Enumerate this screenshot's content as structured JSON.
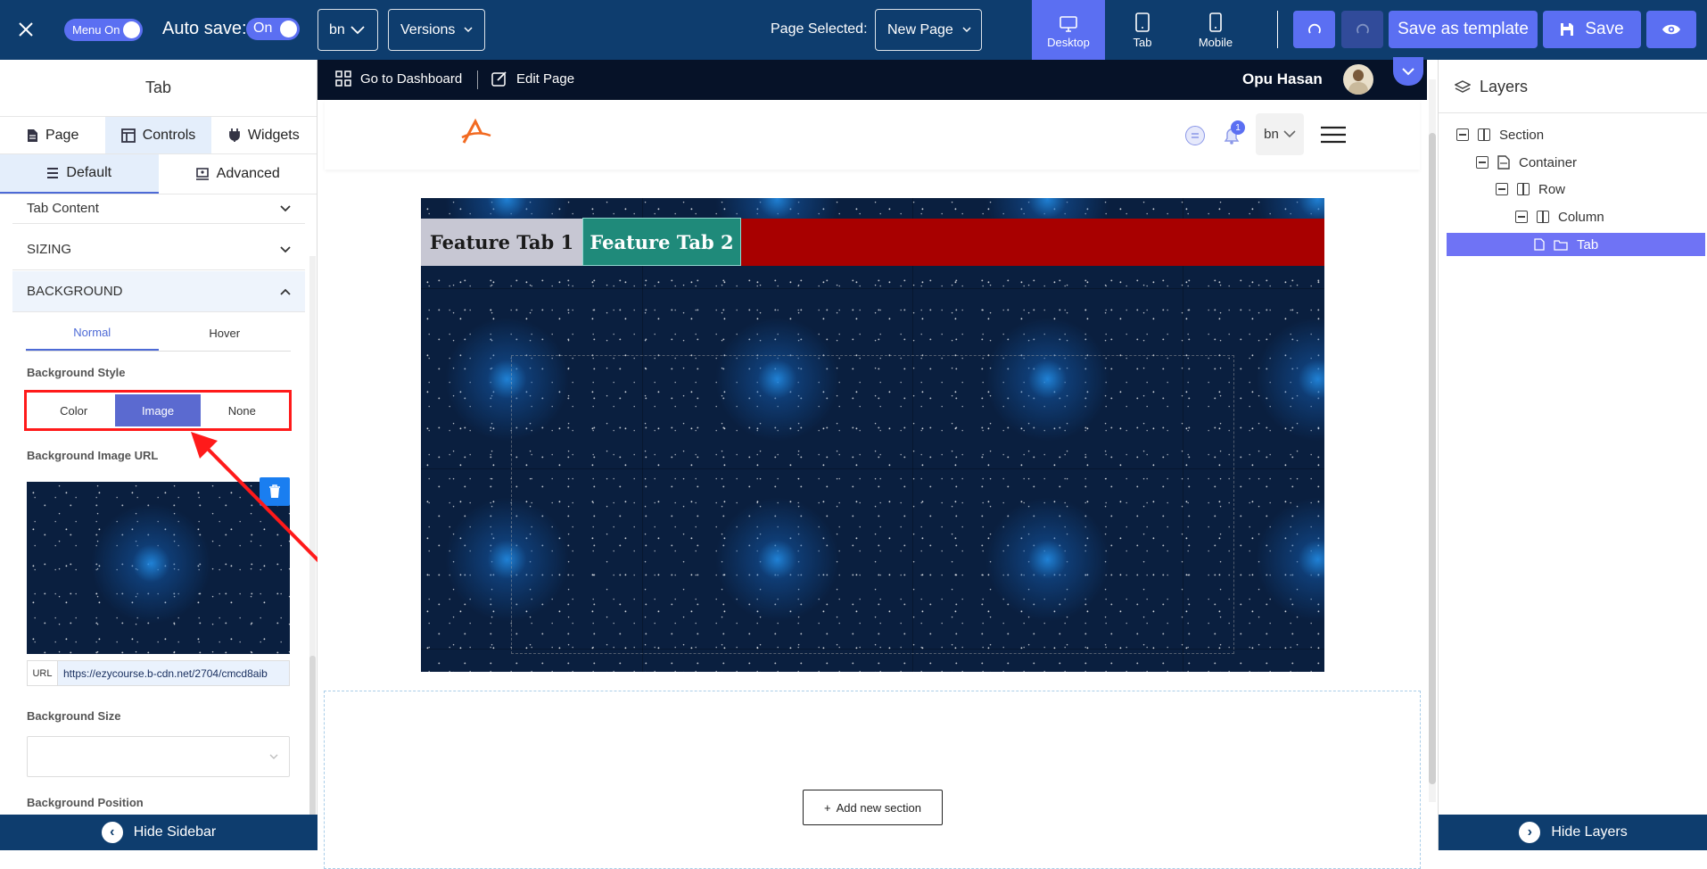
{
  "topbar": {
    "menu_toggle_label": "Menu On",
    "autosave_label": "Auto save:",
    "autosave_state": "On",
    "language": "bn",
    "versions_label": "Versions",
    "page_selected_label": "Page Selected:",
    "page_selected_value": "New Page",
    "devices": [
      "Desktop",
      "Tab",
      "Mobile"
    ],
    "save_template_label": "Save as template",
    "save_label": "Save"
  },
  "sidebar": {
    "title": "Tab",
    "tabs": [
      "Page",
      "Controls",
      "Widgets"
    ],
    "subtabs": [
      "Default",
      "Advanced"
    ],
    "sections": [
      "Tab Content",
      "SIZING",
      "BACKGROUND"
    ],
    "state_tabs": [
      "Normal",
      "Hover"
    ],
    "background_style_label": "Background Style",
    "background_style_options": [
      "Color",
      "Image",
      "None"
    ],
    "background_style_selected": "Image",
    "background_image_url_label": "Background Image URL",
    "url_tag": "URL",
    "url_value": "https://ezycourse.b-cdn.net/2704/cmcd8aib",
    "background_size_label": "Background Size",
    "background_size_value": "",
    "background_position_label": "Background Position",
    "hide_label": "Hide Sidebar"
  },
  "canvas": {
    "dashboard_label": "Go to Dashboard",
    "edit_label": "Edit Page",
    "user_name": "Opu Hasan",
    "notification_count": "1",
    "nav_language": "bn",
    "tab1_label": "Feature Tab 1",
    "tab2_label": "Feature Tab 2",
    "add_section_label": "Add new section"
  },
  "layers": {
    "title": "Layers",
    "items": [
      "Section",
      "Container",
      "Row",
      "Column",
      "Tab"
    ],
    "selected": "Tab",
    "hide_label": "Hide Layers"
  },
  "colors": {
    "topbar": "#0e3d6e",
    "accent": "#5b6ff2",
    "tab_bar": "#a80000",
    "tab2": "#1f8a7a",
    "highlight": "#ff1a1a"
  }
}
